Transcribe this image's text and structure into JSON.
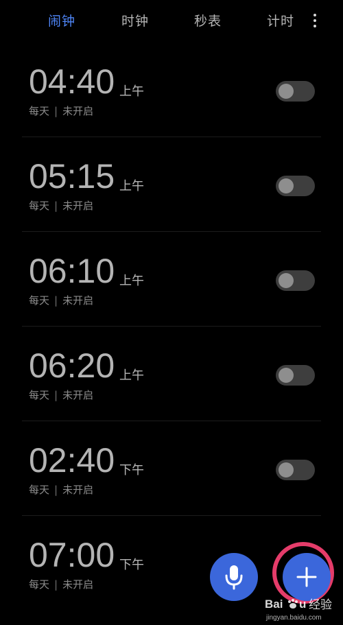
{
  "tabs": [
    {
      "label": "闹钟",
      "active": true
    },
    {
      "label": "时钟",
      "active": false
    },
    {
      "label": "秒表",
      "active": false
    },
    {
      "label": "计时",
      "active": false
    }
  ],
  "more_icon": "more-vertical-icon",
  "alarms": [
    {
      "time": "04:40",
      "period": "上午",
      "repeat": "每天",
      "status": "未开启",
      "enabled": false
    },
    {
      "time": "05:15",
      "period": "上午",
      "repeat": "每天",
      "status": "未开启",
      "enabled": false
    },
    {
      "time": "06:10",
      "period": "上午",
      "repeat": "每天",
      "status": "未开启",
      "enabled": false
    },
    {
      "time": "06:20",
      "period": "上午",
      "repeat": "每天",
      "status": "未开启",
      "enabled": false
    },
    {
      "time": "02:40",
      "period": "下午",
      "repeat": "每天",
      "status": "未开启",
      "enabled": false
    },
    {
      "time": "07:00",
      "period": "下午",
      "repeat": "每天",
      "status": "未开启",
      "enabled": false
    }
  ],
  "separator": "|",
  "buttons": {
    "voice_icon": "microphone-icon",
    "add_icon": "plus-icon"
  },
  "watermark": {
    "brand": "Baidu 经验",
    "url": "jingyan.baidu.com"
  },
  "colors": {
    "accent": "#4f86f7",
    "fab": "#3b67db",
    "highlight": "#e53c6a"
  }
}
